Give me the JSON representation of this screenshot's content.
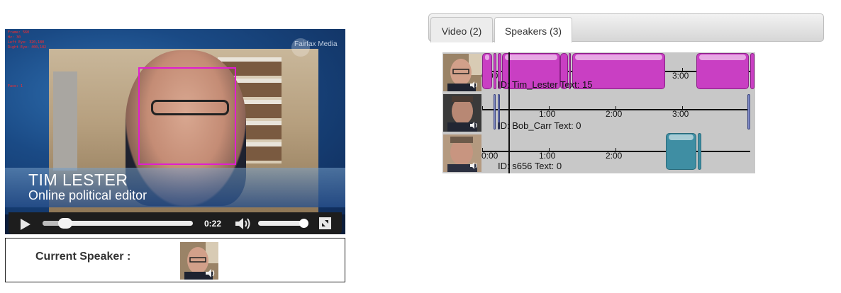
{
  "video": {
    "debug_lines": [
      "Frame: 560",
      "Hz: 30",
      "Left Eye: 320,180",
      "Right Eye: 400,182"
    ],
    "debug_extra": "Face: 1",
    "watermark": "Fairfax Media",
    "lower_third_name": "TIM LESTER",
    "lower_third_role": "Online political editor",
    "time": "0:22",
    "progress": 0.13,
    "volume": 0.95,
    "facebox_color": "#e01ed0"
  },
  "current_speaker": {
    "label": "Current Speaker :"
  },
  "tabs": [
    {
      "label": "Video (2)",
      "active": false
    },
    {
      "label": "Speakers (3)",
      "active": true
    }
  ],
  "timeline": {
    "duration_seconds": 230,
    "tick_labels": [
      "0:00",
      "1:00",
      "2:00",
      "3:00"
    ],
    "playhead_seconds": 22,
    "rows": [
      {
        "id_text": "ID: Tim_Lester Text: 15",
        "color": "#c93fc3",
        "segments": [
          [
            0,
            9
          ],
          [
            10,
            13
          ],
          [
            14,
            17
          ],
          [
            18,
            70
          ],
          [
            70,
            77
          ],
          [
            78,
            80
          ],
          [
            81,
            165
          ],
          [
            193,
            240
          ],
          [
            241,
            245
          ]
        ]
      },
      {
        "id_text": "ID: Bob_Carr Text: 0",
        "color": "#7f89c4",
        "segments": [
          [
            10,
            12
          ],
          [
            14,
            16
          ],
          [
            239,
            241
          ]
        ]
      },
      {
        "id_text": "ID: s656 Text: 0",
        "color": "#3f8ea3",
        "segments": [
          [
            165,
            193
          ],
          [
            194,
            197
          ]
        ]
      }
    ]
  }
}
